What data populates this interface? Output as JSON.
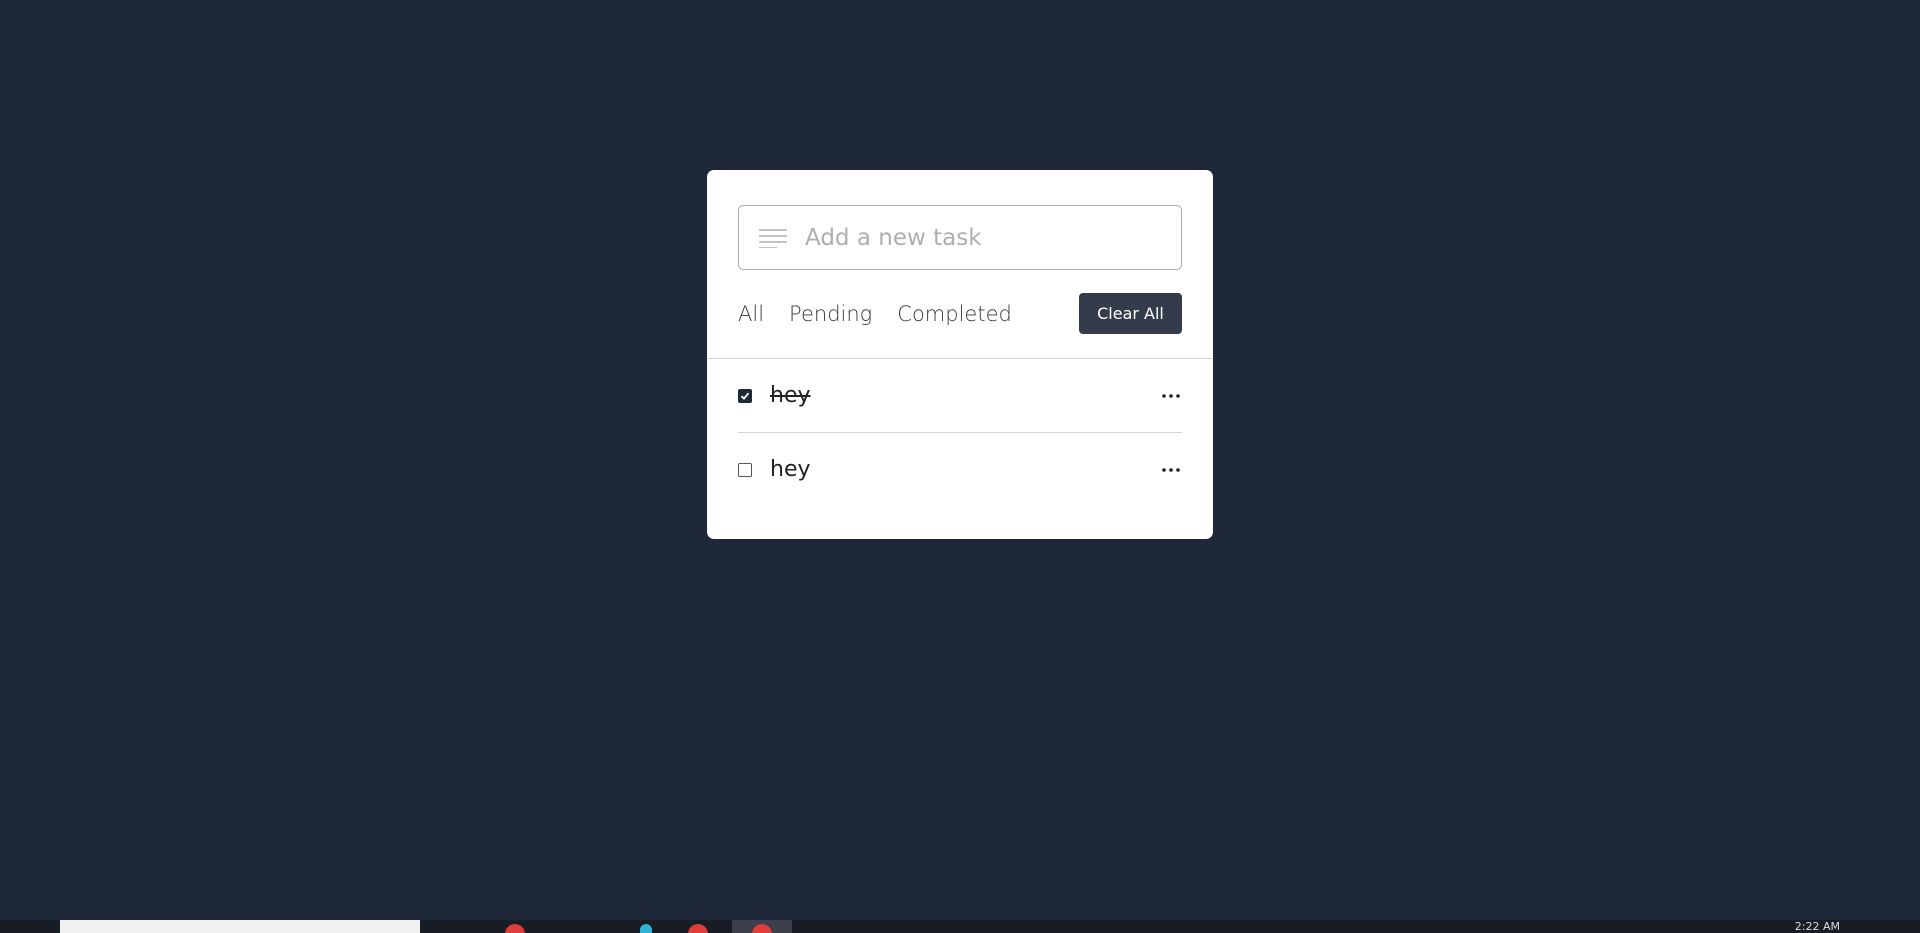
{
  "app": {
    "input_placeholder": "Add a new task",
    "filters": [
      {
        "label": "All"
      },
      {
        "label": "Pending"
      },
      {
        "label": "Completed"
      }
    ],
    "clear_all_label": "Clear All",
    "tasks": [
      {
        "text": "hey",
        "completed": true
      },
      {
        "text": "hey",
        "completed": false
      }
    ]
  },
  "taskbar": {
    "clock": "2:22 AM"
  },
  "colors": {
    "background": "#1f2839",
    "card": "#ffffff",
    "button": "#343c4c"
  },
  "icons": {
    "input_icon": "text-lines-icon",
    "task_menu": "ellipsis-icon"
  }
}
